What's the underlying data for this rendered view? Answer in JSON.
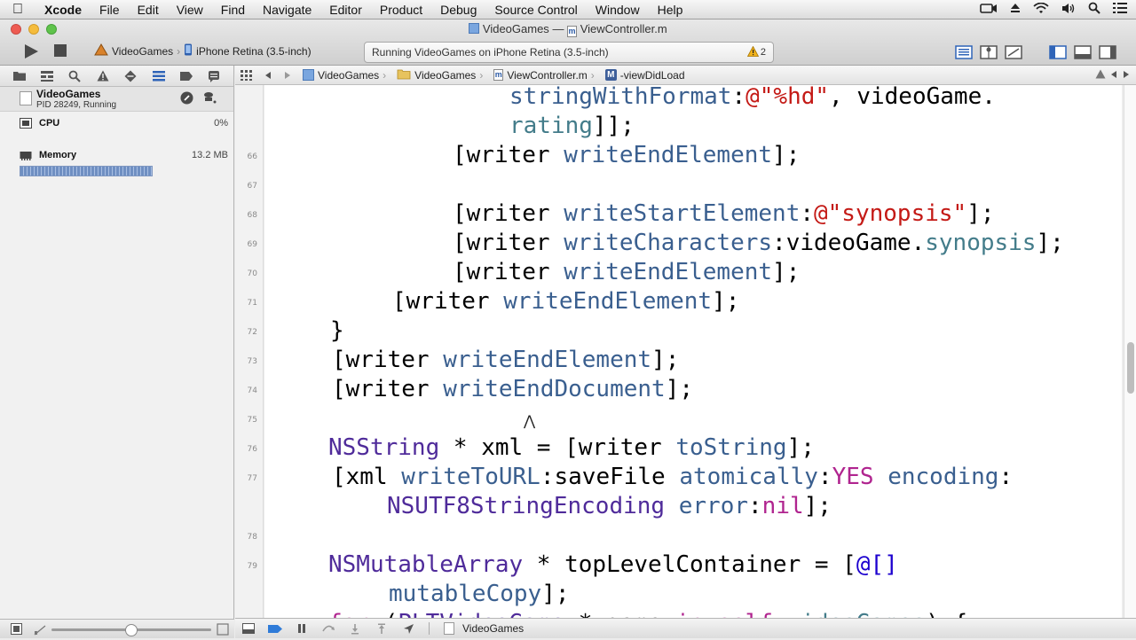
{
  "menubar": {
    "app": "Xcode",
    "items": [
      "File",
      "Edit",
      "View",
      "Find",
      "Navigate",
      "Editor",
      "Product",
      "Debug",
      "Source Control",
      "Window",
      "Help"
    ]
  },
  "window": {
    "title_project": "VideoGames",
    "title_separator": "—",
    "title_file": "ViewController.m"
  },
  "toolbar": {
    "scheme": "VideoGames",
    "device": "iPhone Retina (3.5-inch)",
    "activity": "Running VideoGames on iPhone Retina (3.5-inch)",
    "warning_count": "2"
  },
  "navigator": {
    "process_name": "VideoGames",
    "process_status": "PID 28249, Running",
    "cpu_label": "CPU",
    "cpu_value": "0%",
    "memory_label": "Memory",
    "memory_value": "13.2 MB"
  },
  "jumpbar": {
    "project": "VideoGames",
    "group": "VideoGames",
    "file": "ViewController.m",
    "symbol": "-viewDidLoad"
  },
  "editor": {
    "line_numbers": [
      "66",
      "67",
      "68",
      "69",
      "70",
      "71",
      "72",
      "73",
      "74",
      "75",
      "76",
      "77",
      "78",
      "79"
    ]
  },
  "debugbar": {
    "target": "VideoGames"
  },
  "colors": {
    "keyword": "#b0248f",
    "class": "#4f2b9a",
    "string": "#c41a16",
    "method": "#3a5f8f",
    "property": "#437c8a"
  }
}
